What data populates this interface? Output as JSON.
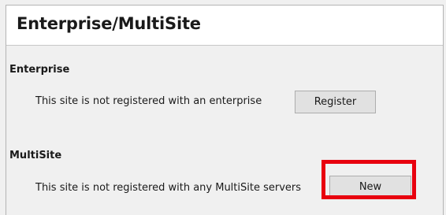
{
  "page": {
    "title": "Enterprise/MultiSite"
  },
  "enterprise": {
    "heading": "Enterprise",
    "status_text": "This site is not registered with an enterprise",
    "register_label": "Register"
  },
  "multisite": {
    "heading": "MultiSite",
    "status_text": "This site is not registered with any MultiSite servers",
    "new_label": "New"
  },
  "colors": {
    "highlight": "#e8000e"
  }
}
